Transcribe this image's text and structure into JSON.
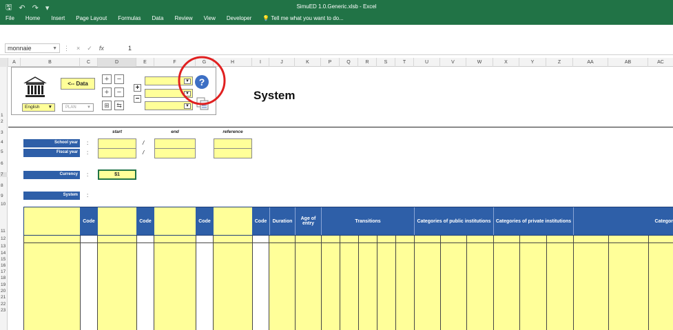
{
  "window": {
    "title": "SimuED 1.0.Generic.xlsb - Excel",
    "qat_icons": [
      "save-icon",
      "undo-icon",
      "redo-icon",
      "customize-icon"
    ]
  },
  "ribbon": {
    "tabs": [
      "File",
      "Home",
      "Insert",
      "Page Layout",
      "Formulas",
      "Data",
      "Review",
      "View",
      "Developer"
    ],
    "tell_me": "Tell me what you want to do..."
  },
  "formula_bar": {
    "name_box": "monnaie",
    "cancel": "×",
    "enter": "✓",
    "fx": "fx",
    "value": "1"
  },
  "columns": [
    "A",
    "B",
    "C",
    "D",
    "E",
    "F",
    "G",
    "H",
    "I",
    "J",
    "K",
    "P",
    "Q",
    "R",
    "S",
    "T",
    "U",
    "V",
    "W",
    "X",
    "Y",
    "Z",
    "AA",
    "AB",
    "AC"
  ],
  "rows": [
    "1",
    "2",
    "3",
    "4",
    "5",
    "6",
    "7",
    "8",
    "9",
    "10",
    "11",
    "12",
    "13",
    "14",
    "15",
    "16",
    "17",
    "18",
    "19",
    "20",
    "21",
    "22",
    "23"
  ],
  "panel": {
    "data_button": "<-- Data",
    "language": "English",
    "mode": "PLAN",
    "help": "?"
  },
  "sheet": {
    "title": "System",
    "col_start": "start",
    "col_end": "end",
    "col_reference": "reference",
    "school_year": "School year",
    "fiscal_year": "Fiscal year",
    "currency": "Currency",
    "currency_value": "$1",
    "system": "System",
    "colon": ":",
    "slash": "/"
  },
  "table_headers": {
    "code": "Code",
    "duration": "Duration",
    "age_of_entry": "Age of entry",
    "transitions": "Transitions",
    "public": "Categories of public institutions",
    "private": "Categories of private institutions",
    "categories": "Categor"
  },
  "colors": {
    "excel_green": "#217346",
    "header_blue": "#2e5fa8",
    "cell_yellow": "#ffff99",
    "annotation_red": "#e02020"
  }
}
